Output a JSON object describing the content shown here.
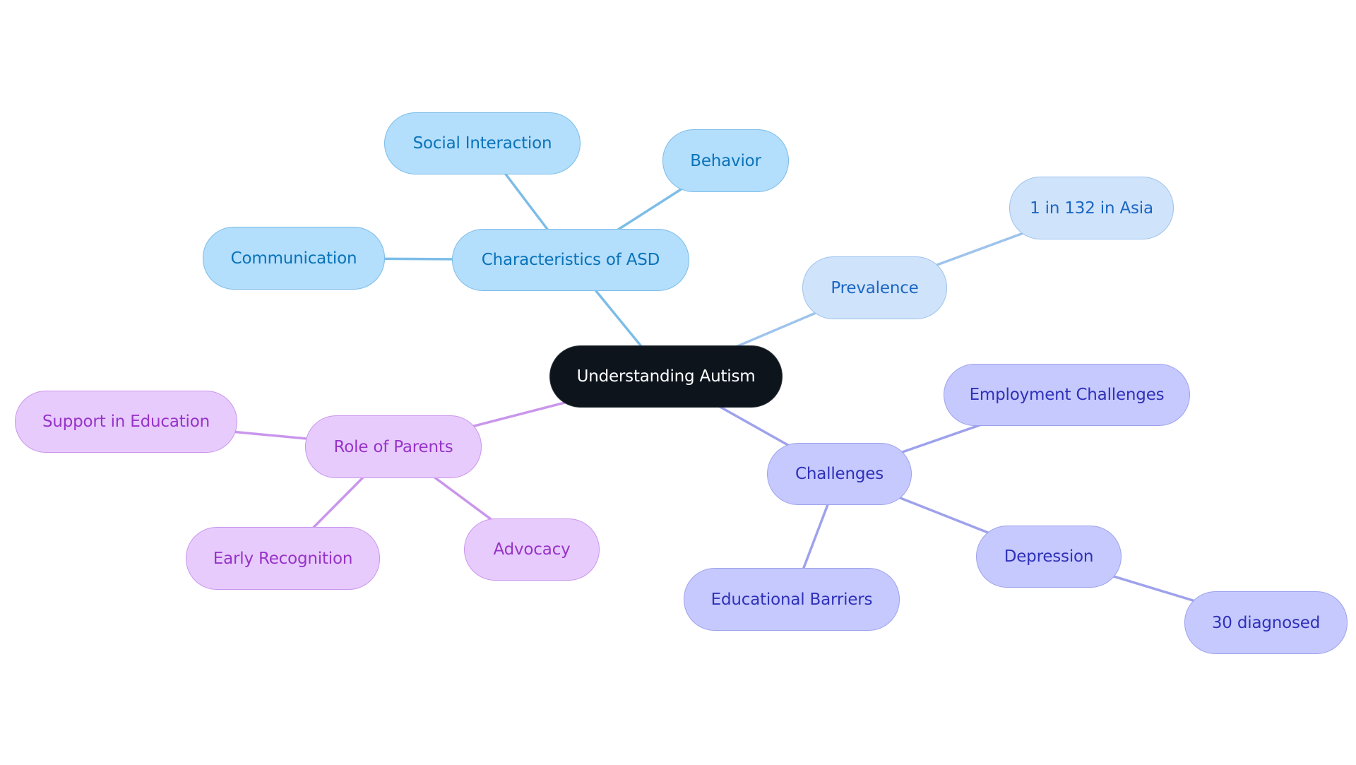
{
  "diagram": {
    "type": "mind-map",
    "root": {
      "id": "root",
      "label": "Understanding Autism"
    },
    "branches": [
      {
        "id": "asd",
        "label": "Characteristics of ASD",
        "color": "#7cbde8",
        "children": [
          {
            "id": "social",
            "label": "Social Interaction"
          },
          {
            "id": "behavior",
            "label": "Behavior"
          },
          {
            "id": "communication",
            "label": "Communication"
          }
        ]
      },
      {
        "id": "prevalence",
        "label": "Prevalence",
        "color": "#9ec3ec",
        "children": [
          {
            "id": "asia",
            "label": "1 in 132 in Asia"
          }
        ]
      },
      {
        "id": "parents",
        "label": "Role of Parents",
        "color": "#c996ec",
        "children": [
          {
            "id": "support",
            "label": "Support in Education"
          },
          {
            "id": "early",
            "label": "Early Recognition"
          },
          {
            "id": "advocacy",
            "label": "Advocacy"
          }
        ]
      },
      {
        "id": "challenges",
        "label": "Challenges",
        "color": "#9ea2ec",
        "children": [
          {
            "id": "employment",
            "label": "Employment Challenges"
          },
          {
            "id": "depression",
            "label": "Depression",
            "children": [
              {
                "id": "diagnosed",
                "label": "30 diagnosed"
              }
            ]
          },
          {
            "id": "barriers",
            "label": "Educational Barriers"
          }
        ]
      }
    ]
  }
}
